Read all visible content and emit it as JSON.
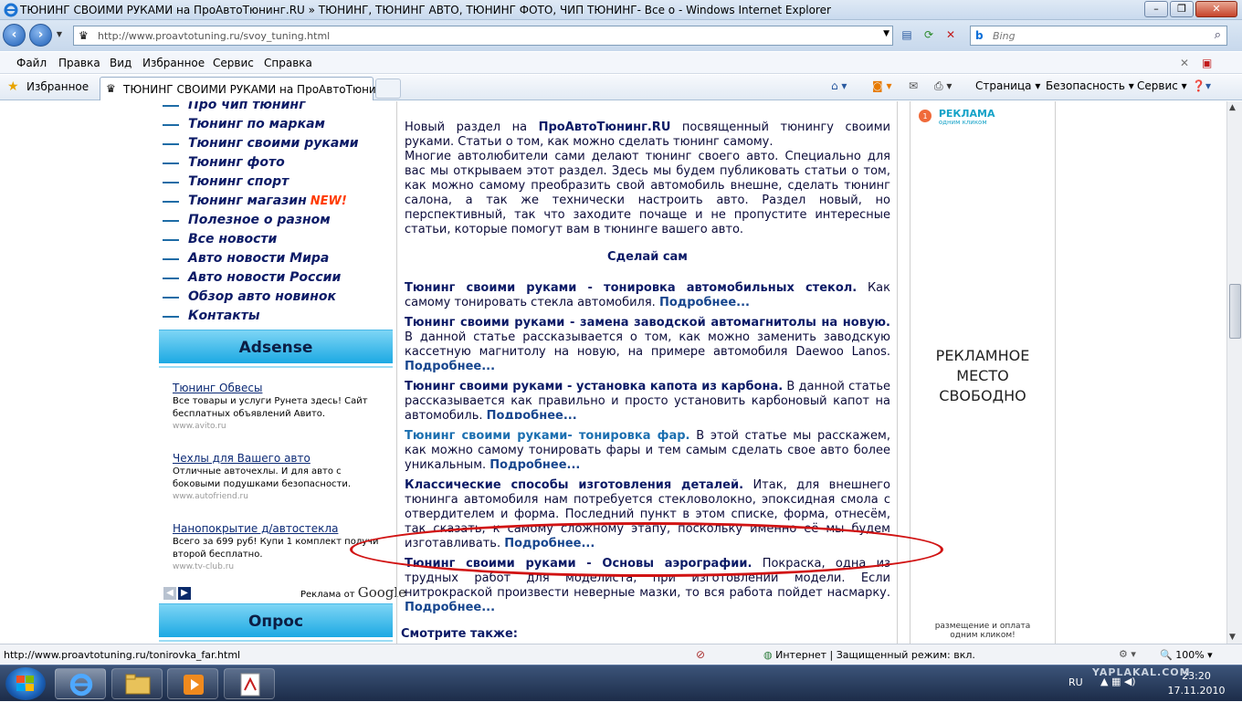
{
  "window": {
    "title": "ТЮНИНГ СВОИМИ РУКАМИ на ПроАвтоТюнинг.RU » ТЮНИНГ, ТЮНИНГ АВТО, ТЮНИНГ ФОТО, ЧИП ТЮНИНГ- Все о  - Windows Internet Explorer"
  },
  "address": {
    "url": "http://www.proavtotuning.ru/svoy_tuning.html",
    "search_placeholder": "Bing"
  },
  "menu": [
    "Файл",
    "Правка",
    "Вид",
    "Избранное",
    "Сервис",
    "Справка"
  ],
  "favbar": {
    "favorites": "Избранное",
    "tab_title": "ТЮНИНГ СВОИМИ РУКАМИ на ПроАвтоТюни...",
    "commands": [
      "Страница",
      "Безопасность",
      "Сервис"
    ]
  },
  "left_menu": [
    "Про чип тюнинг",
    "Тюнинг по маркам",
    "Тюнинг своими руками",
    "Тюнинг фото",
    "Тюнинг спорт",
    "Тюнинг магазин",
    "Полезное о разном",
    "Все новости",
    "Авто новости Мира",
    "Авто новости России",
    "Обзор авто новинок",
    "Контакты"
  ],
  "left_menu_new": "NEW!",
  "adsense": {
    "title": "Adsense",
    "ads": [
      {
        "title": "Тюнинг Обвесы",
        "desc": "Все товары и услуги Рунета здесь! Сайт бесплатных объявлений Авито.",
        "url": "www.avito.ru"
      },
      {
        "title": "Чехлы для Вашего авто",
        "desc": "Отличные авточехлы. И для авто с боковыми подушками безопасности.",
        "url": "www.autofriend.ru"
      },
      {
        "title": "Нанопокрытие д/автостекла",
        "desc": "Всего за 699 руб! Купи 1 комплект получи второй бесплатно.",
        "url": "www.tv-club.ru"
      }
    ],
    "ads_by": "Реклама от",
    "google": "Google"
  },
  "poll": {
    "title": "Опрос"
  },
  "intro": {
    "p1_a": "Новый раздел на ",
    "p1_brand": "ПроАвтоТюнинг.RU",
    "p1_b": " посвященный тюнингу своими руками. Статьи о том, как можно сделать тюнинг самому.",
    "p2": "Многие автолюбители сами делают тюнинг своего авто. Специально для вас мы открываем этот раздел. Здесь мы будем публиковать статьи о том, как можно самому преобразить свой автомобиль внешне, сделать тюнинг салона, а так же технически настроить авто. Раздел новый, но перспективный, так что заходите почаще и не пропустите интересные статьи, которые помогут вам в тюнинге вашего авто."
  },
  "section_title": "Сделай сам",
  "more": "Подробнее...",
  "articles": [
    {
      "title": "Тюнинг своими руками - тонировка автомобильных стекол.",
      "text": " Как самому тонировать стекла автомобиля. "
    },
    {
      "title": "Тюнинг своими руками - замена заводской автомагнитолы на новую.",
      "text": " В данной статье рассказывается о том, как можно заменить заводскую кассетную магнитолу на новую, на примере автомобиля Daewoo Lanos. "
    },
    {
      "title": "Тюнинг своими руками - установка капота из карбона.",
      "text": " В данной статье рассказывается как правильно и просто установить карбоновый капот на автомобиль. "
    },
    {
      "title": "Тюнинг своими руками- тонировка фар.",
      "text": " В этой статье мы расскажем, как можно самому тонировать фары и тем самым сделать свое авто более уникальным. "
    },
    {
      "title": "Классические способы изготовления деталей.",
      "text": " Итак, для внешнего тюнинга автомобиля нам потребуется стекловолокно, эпоксидная смола с отвердителем и форма. Последний пункт в этом списке, форма, отнесём, так сказать, к самому сложному этапу, поскольку именно её мы будем изготавливать. "
    },
    {
      "title": "Тюнинг своими руками - Основы аэрографии.",
      "text": " Покраска, одна из трудных работ для моделиста, при изготовлении модели. Если нитрокраской произвести неверные мазки, то вся работа пойдет насмарку. "
    }
  ],
  "see_also": "Смотрите также:",
  "right_ad": {
    "logo_line1": "РЕКЛАМА",
    "logo_line2": "одним кликом",
    "free_l1": "РЕКЛАМНОЕ",
    "free_l2": "МЕСТО",
    "free_l3": "СВОБОДНО",
    "foot_l1": "размещение и оплата",
    "foot_l2": "одним кликом!"
  },
  "status": {
    "url": "http://www.proavtotuning.ru/tonirovka_far.html",
    "zone": "Интернет | Защищенный режим: вкл.",
    "zoom": "100%"
  },
  "taskbar": {
    "lang": "RU",
    "time": "23:20",
    "date": "17.11.2010"
  },
  "watermark": "YAPLAKAL.COM",
  "colors": {
    "accent": "#1ca9e3",
    "link": "#0b1a66",
    "highlight": "#d11313",
    "new": "#ff3a00"
  }
}
